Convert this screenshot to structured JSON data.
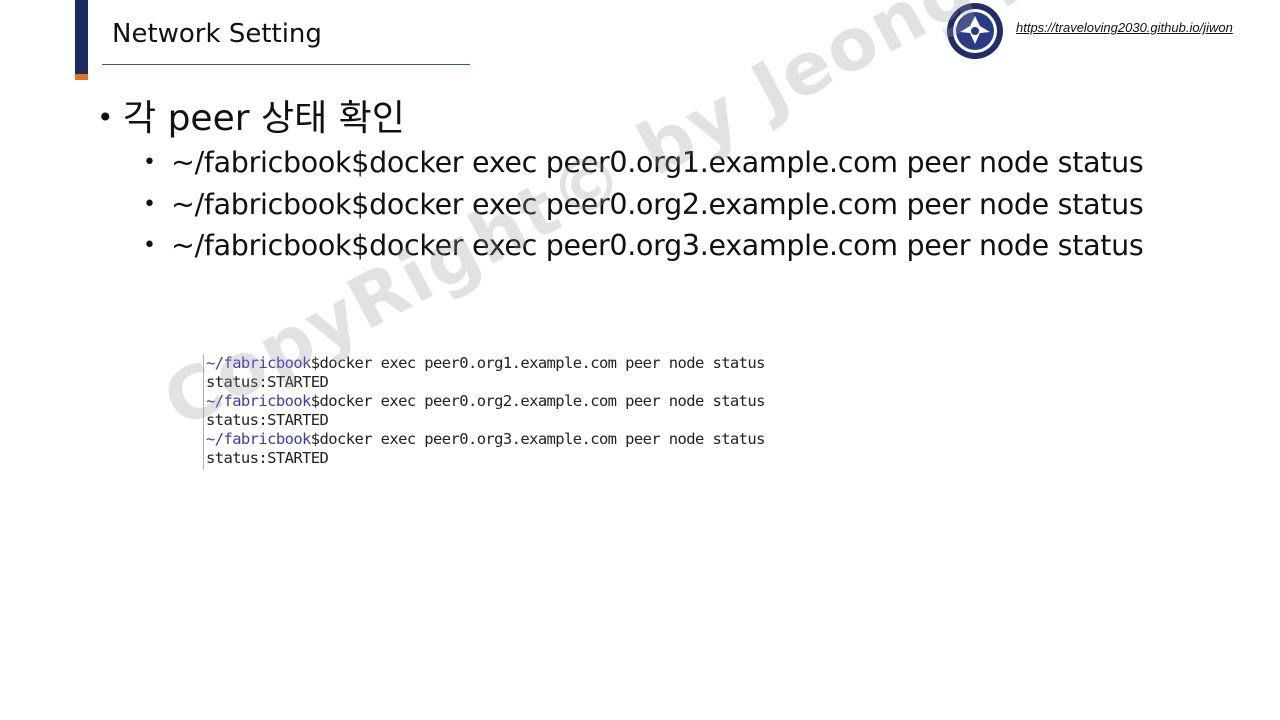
{
  "header": {
    "title": "Network Setting",
    "url": "https://traveloving2030.github.io/jiwon",
    "logo_icon": "university-seal-icon",
    "accent_color": "#1b2b5e",
    "accent_tip_color": "#e0731e"
  },
  "main": {
    "heading_bullet": "•",
    "heading": "각 peer 상태 확인",
    "sub_bullet": "•",
    "commands": [
      "~/fabricbook$docker exec peer0.org1.example.com peer node status",
      "~/fabricbook$docker exec peer0.org2.example.com peer node status",
      "~/fabricbook$docker exec peer0.org3.example.com peer node status"
    ]
  },
  "terminal": {
    "lines": [
      {
        "prompt": "~/fabricbook",
        "text": "$docker exec peer0.org1.example.com peer node status"
      },
      {
        "prompt": "",
        "text": "status:STARTED"
      },
      {
        "prompt": "~/fabricbook",
        "text": "$docker exec peer0.org2.example.com peer node status"
      },
      {
        "prompt": "",
        "text": "status:STARTED"
      },
      {
        "prompt": "~/fabricbook",
        "text": "$docker exec peer0.org3.example.com peer node status"
      },
      {
        "prompt": "",
        "text": "status:STARTED"
      }
    ],
    "prompt_color": "#3a3ab8"
  },
  "watermark": {
    "text": "CopyRight© by Jeong JiWon"
  }
}
